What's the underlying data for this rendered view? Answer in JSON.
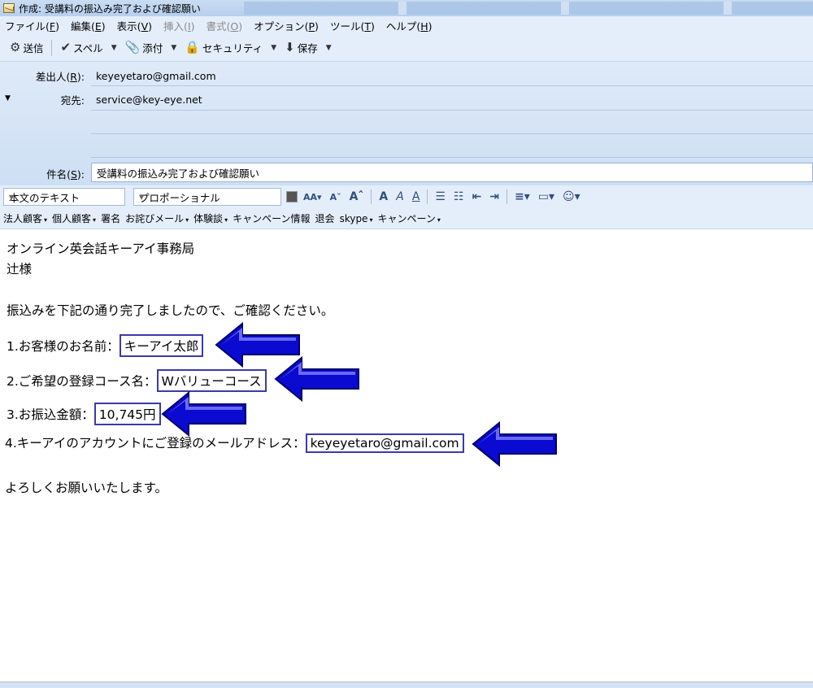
{
  "window": {
    "title": "作成: 受講料の振込み完了および確認願い"
  },
  "menubar": {
    "items": [
      {
        "label": "ファイル(",
        "key": "F",
        "end": ")",
        "disabled": false
      },
      {
        "label": "編集(",
        "key": "E",
        "end": ")",
        "disabled": false
      },
      {
        "label": "表示(",
        "key": "V",
        "end": ")",
        "disabled": false
      },
      {
        "label": "挿入(",
        "key": "I",
        "end": ")",
        "disabled": true
      },
      {
        "label": "書式(",
        "key": "O",
        "end": ")",
        "disabled": true
      },
      {
        "label": "オプション(",
        "key": "P",
        "end": ")",
        "disabled": false
      },
      {
        "label": "ツール(",
        "key": "T",
        "end": ")",
        "disabled": false
      },
      {
        "label": "ヘルプ(",
        "key": "H",
        "end": ")",
        "disabled": false
      }
    ]
  },
  "toolbar": {
    "send_label": "送信",
    "spell_label": "スペル",
    "attach_label": "添付",
    "security_label": "セキュリティ",
    "save_label": "保存"
  },
  "headers": {
    "from_label": "差出人(",
    "from_key": "R",
    "from_end": "):",
    "from_value": "keyeyetaro@gmail.com",
    "to_label": "宛先:",
    "to_value": "service@key-eye.net",
    "subject_label": "件名(",
    "subject_key": "S",
    "subject_end": "):",
    "subject_value": "受講料の振込み完了および確認願い"
  },
  "format": {
    "paragraph_style": "本文のテキスト",
    "font": "プロポーショナル"
  },
  "snippets": {
    "items": [
      "法人顧客",
      "個人顧客",
      "署名",
      "お詫びメール",
      "体験談",
      "キャンペーン情報",
      "退会",
      "skype",
      "キャンペーン"
    ]
  },
  "message": {
    "greeting_company": "オンライン英会話キーアイ事務局",
    "greeting_name": "辻様",
    "intro": "振込みを下記の通り完了しましたので、ご確認ください。",
    "item1_label": "1.お客様のお名前：",
    "item1_value": "キーアイ太郎",
    "item2_label": "2.ご希望の登録コース名：",
    "item2_value": "Wバリューコース",
    "item3_label": "3.お振込金額：",
    "item3_value": "10,745円",
    "item4_label": "4.キーアイのアカウントにご登録のメールアドレス：",
    "item4_value": "keyeyetaro@gmail.com",
    "closing": "よろしくお願いいたします。"
  },
  "colors": {
    "highlight_border": "#3a3aaa",
    "arrow_fill": "#0a0ad0",
    "chrome_bg": "#e4eefb"
  }
}
